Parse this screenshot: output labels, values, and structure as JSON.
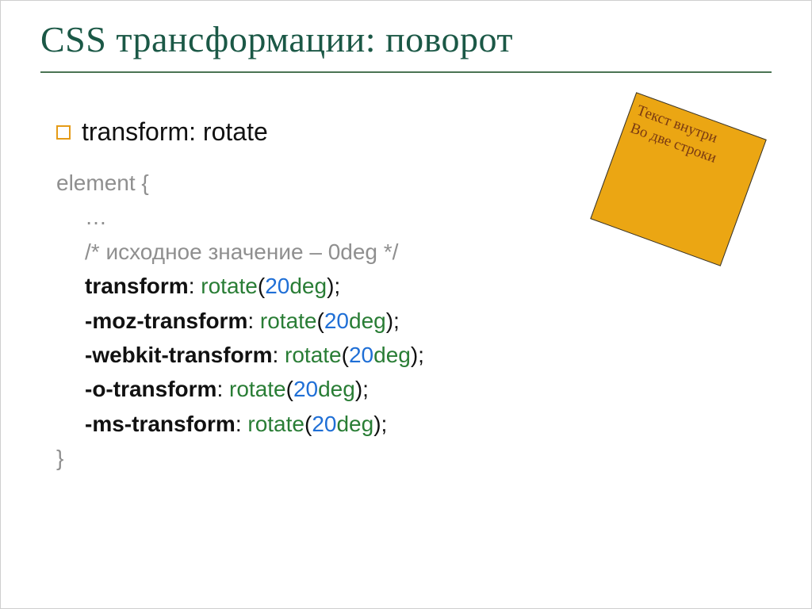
{
  "title": "CSS трансформации: поворот",
  "bullet": "transform: rotate",
  "code": {
    "selector": "element {",
    "ellipsis": "…",
    "comment": "/* исходное значение – 0deg */",
    "lines": [
      {
        "prop": "transform",
        "punct1": ": ",
        "func": "rotate",
        "lp": "(",
        "num": "20",
        "unit": "deg",
        "rp": ")",
        "end": ";"
      },
      {
        "prop": "-moz-transform",
        "punct1": ": ",
        "func": "rotate",
        "lp": "(",
        "num": "20",
        "unit": "deg",
        "rp": ")",
        "end": ";"
      },
      {
        "prop": "-webkit-transform",
        "punct1": ": ",
        "func": "rotate",
        "lp": "(",
        "num": "20",
        "unit": "deg",
        "rp": ")",
        "end": ";"
      },
      {
        "prop": "-o-transform",
        "punct1": ": ",
        "func": "rotate",
        "lp": "(",
        "num": "20",
        "unit": "deg",
        "rp": ")",
        "end": ";"
      },
      {
        "prop": "-ms-transform",
        "punct1": ": ",
        "func": "rotate",
        "lp": "(",
        "num": "20",
        "unit": "deg",
        "rp": ")",
        "end": ";"
      }
    ],
    "close": "}"
  },
  "sticky": {
    "line1": "Текст внутри",
    "line2": "Во две строки"
  }
}
